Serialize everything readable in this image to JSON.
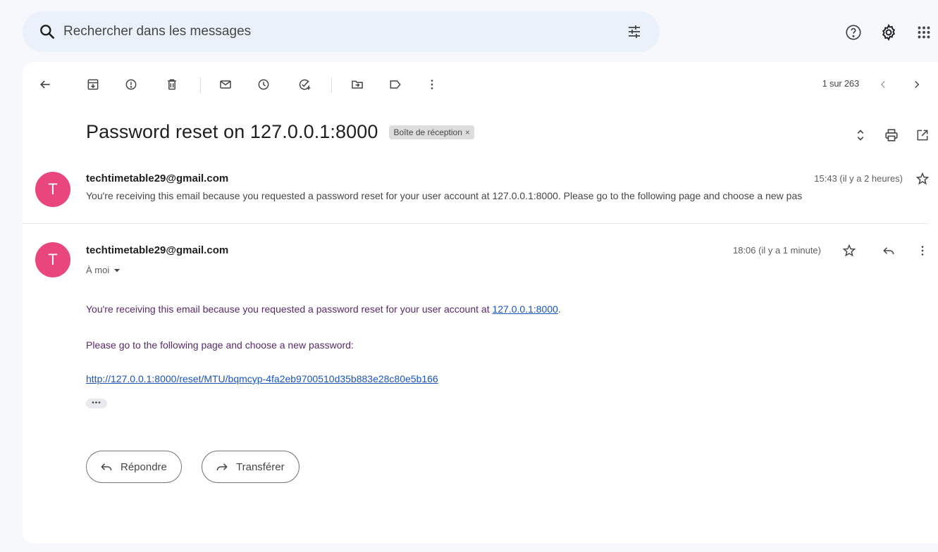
{
  "search": {
    "placeholder": "Rechercher dans les messages"
  },
  "pager": {
    "text": "1 sur 263"
  },
  "thread": {
    "subject": "Password reset on 127.0.0.1:8000",
    "label": "Boîte de réception",
    "label_remove": "×"
  },
  "messages": [
    {
      "avatar_letter": "T",
      "sender": "techtimetable29@gmail.com",
      "time": "15:43 (il y a 2 heures)",
      "snippet": "You're receiving this email because you requested a password reset for your user account at 127.0.0.1:8000. Please go to the following page and choose a new pas"
    },
    {
      "avatar_letter": "T",
      "sender": "techtimetable29@gmail.com",
      "time": "18:06 (il y a 1 minute)",
      "recipient": "À moi",
      "body_line1": "You're receiving this email because you requested a password reset for your user account at ",
      "body_link1": "127.0.0.1:8000",
      "body_line1_end": ".",
      "body_line2": "Please go to the following page and choose a new password:",
      "reset_link": "http://127.0.0.1:8000/reset/MTU/bqmcyp-4fa2eb9700510d35b883e28c80e5b166",
      "trimmed": "•••"
    }
  ],
  "actions": {
    "reply": "Répondre",
    "forward": "Transférer"
  },
  "colors": {
    "avatar": "#e8467c",
    "link": "#1a55b8",
    "body_text": "#5a2a6a",
    "search_bg": "#eaf1fb"
  },
  "icons": {
    "search": "search-icon",
    "tune": "tune-icon",
    "help": "help-icon",
    "settings": "gear-icon",
    "apps": "apps-icon",
    "back": "back-arrow-icon",
    "archive": "archive-icon",
    "spam": "report-spam-icon",
    "delete": "trash-icon",
    "unread": "mail-icon",
    "snooze": "clock-icon",
    "task": "add-task-icon",
    "move": "move-to-icon",
    "label": "label-icon",
    "more": "more-vert-icon",
    "prev": "chevron-left-icon",
    "next": "chevron-right-icon",
    "expand": "expand-all-icon",
    "print": "print-icon",
    "new_window": "open-in-new-icon",
    "star": "star-icon",
    "reply": "reply-icon",
    "forward": "forward-icon"
  }
}
